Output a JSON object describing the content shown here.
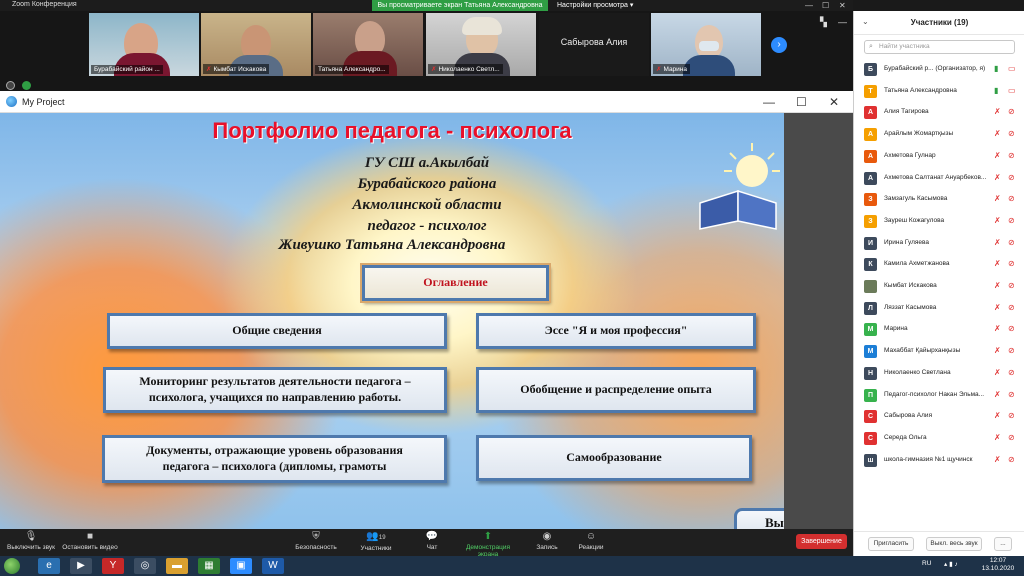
{
  "titlebar": {
    "app_title": "Zoom Конференция",
    "share_banner": "Вы просматриваете экран Татьяна Александровна",
    "view_settings": "Настройки просмотра ▾"
  },
  "strip_tiles": [
    {
      "name": "Бурабайский район ...",
      "muted": false
    },
    {
      "name": "Кымбат Искакова",
      "muted": true
    },
    {
      "name": "Татьяна Александро...",
      "muted": false
    },
    {
      "name": "Николаенко Светл...",
      "muted": true
    },
    {
      "name": "Сабырова Алия",
      "muted": false,
      "plain": true
    },
    {
      "name": "Марина",
      "muted": true
    }
  ],
  "shared_window": {
    "title": "My Project"
  },
  "slide": {
    "title": "Портфолио педагога - психолога",
    "lines": [
      "ГУ СШ а.Акылбай",
      "Бурабайского района",
      "Акмолинской области",
      "педагог - психолог",
      "Живушко Татьяна Александровна"
    ],
    "toc": "Оглавление",
    "buttons": {
      "general": "Общие  сведения",
      "essay": "Эссе \"Я и моя профессия\"",
      "monitoring": "Мониторинг результатов деятельности педагога – психолога, учащихся по направлению работы.",
      "experience": "Обобщение и распределение опыта",
      "documents": "Документы, отражающие уровень образования педагога – психолога (дипломы, грамоты",
      "self_education": "Самообразование"
    },
    "exit_partial": "Вы"
  },
  "toolbar": {
    "mute": "Выключить звук",
    "video": "Остановить видео",
    "security": "Безопасность",
    "participants": "Участники",
    "participants_count": "19",
    "chat": "Чат",
    "share": "Демонстрация экрана",
    "record": "Запись",
    "reactions": "Реакции",
    "end": "Завершение"
  },
  "panel": {
    "title": "Участники (19)",
    "search_placeholder": "Найти участника",
    "invite": "Пригласить",
    "mute_all": "Выкл. весь звук",
    "more": "...",
    "participants": [
      {
        "initial": "Б",
        "name": "Бурабайский р... (Организатор, я)",
        "color": "#3d4a5c",
        "mic_on": true
      },
      {
        "initial": "Т",
        "name": "Татьяна Александровна",
        "color": "#f59f00",
        "mic_on": true
      },
      {
        "initial": "А",
        "name": "Алия Тагирова",
        "color": "#e03131",
        "mic_on": false
      },
      {
        "initial": "А",
        "name": "Арайлым Жомартқызы",
        "color": "#f59f00",
        "mic_on": false
      },
      {
        "initial": "А",
        "name": "Ахметова Гулнар",
        "color": "#e8590c",
        "mic_on": false
      },
      {
        "initial": "А",
        "name": "Ахметова Салтанат Ануарбеков...",
        "color": "#3d4a5c",
        "mic_on": false
      },
      {
        "initial": "З",
        "name": "Замзагуль Касымова",
        "color": "#e8590c",
        "mic_on": false
      },
      {
        "initial": "З",
        "name": "Зауреш Кожагулова",
        "color": "#f59f00",
        "mic_on": false
      },
      {
        "initial": "И",
        "name": "Ирина Гуляева",
        "color": "#3d4a5c",
        "mic_on": false
      },
      {
        "initial": "К",
        "name": "Камила Ахметжанова",
        "color": "#3d4a5c",
        "mic_on": false
      },
      {
        "initial": "",
        "name": "Кымбат Искакова",
        "color": "#6b7b5a",
        "mic_on": false
      },
      {
        "initial": "Л",
        "name": "Ляззат Касымова",
        "color": "#3d4a5c",
        "mic_on": false
      },
      {
        "initial": "М",
        "name": "Марина",
        "color": "#37b24d",
        "mic_on": false
      },
      {
        "initial": "М",
        "name": "Махаббат Қайырханқызы",
        "color": "#1c7ed6",
        "mic_on": false
      },
      {
        "initial": "Н",
        "name": "Николаенко Светлана",
        "color": "#3d4a5c",
        "mic_on": false
      },
      {
        "initial": "П",
        "name": "Педагог-психолог Накан Эльма...",
        "color": "#37b24d",
        "mic_on": false
      },
      {
        "initial": "С",
        "name": "Сабырова Алия",
        "color": "#e03131",
        "mic_on": false
      },
      {
        "initial": "С",
        "name": "Середа Ольга",
        "color": "#e03131",
        "mic_on": false
      },
      {
        "initial": "ш",
        "name": "школа-гимназия №1 щучинск",
        "color": "#3d4a5c",
        "mic_on": false
      }
    ]
  },
  "taskbar": {
    "lang": "RU",
    "time": "12:07",
    "date": "13.10.2020"
  }
}
